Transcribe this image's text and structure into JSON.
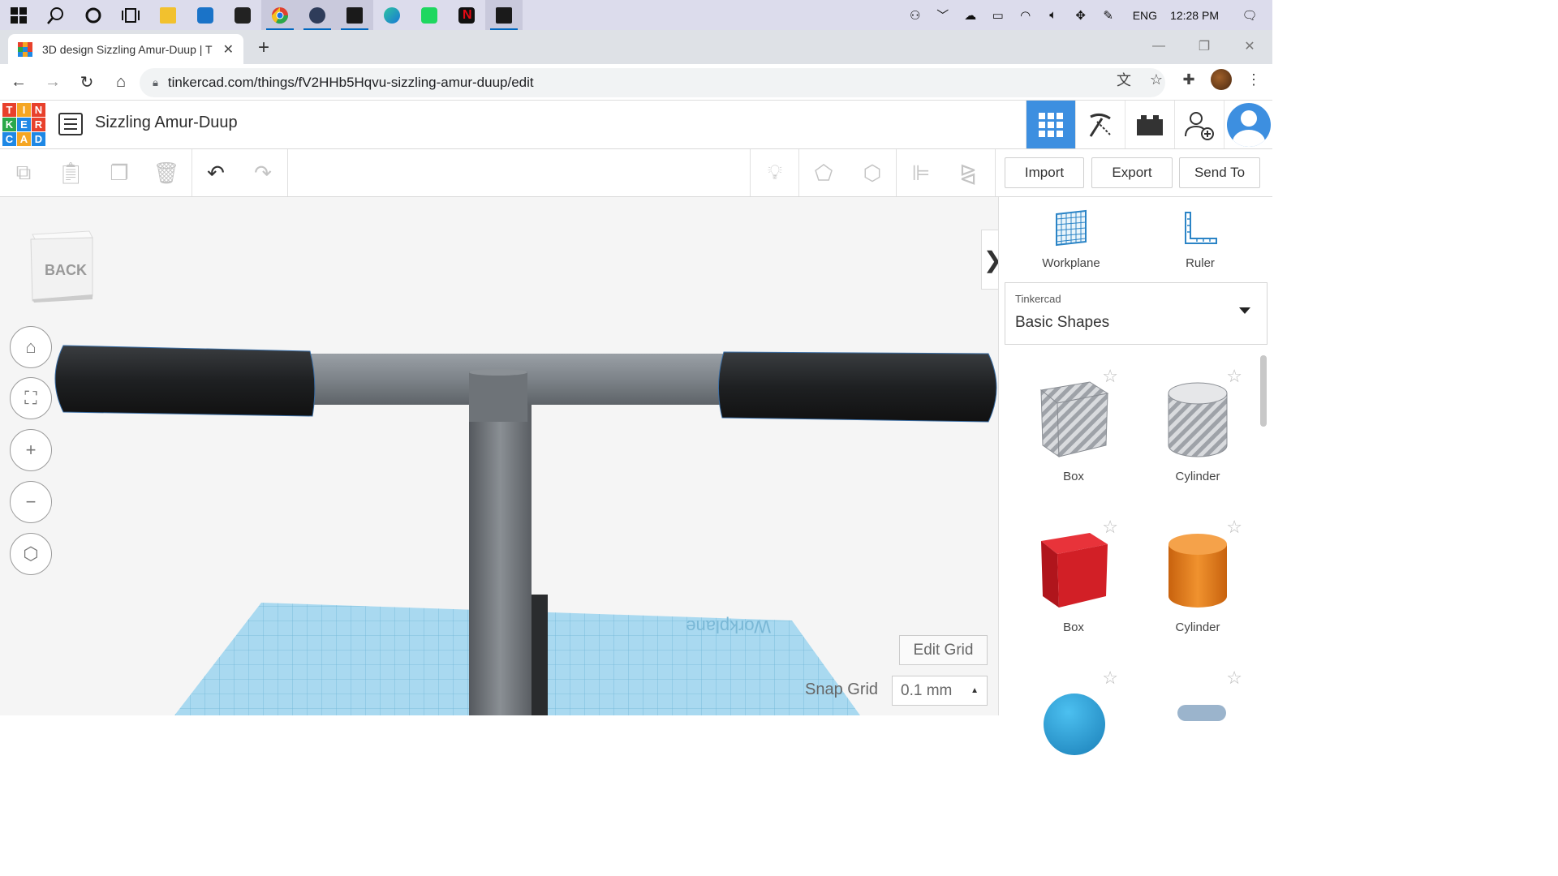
{
  "taskbar": {
    "time": "12:28 PM",
    "language": "ENG",
    "icons": [
      "windows-start-icon",
      "search-icon",
      "cortana-icon",
      "task-view-icon",
      "file-explorer-icon",
      "mail-icon",
      "store-icon",
      "chrome-icon",
      "shield-app-icon",
      "epic-games-icon",
      "edge-icon",
      "spotify-icon",
      "netflix-icon",
      "epic-games-icon-2"
    ]
  },
  "browser": {
    "tab_title": "3D design Sizzling Amur-Duup | T",
    "url": "tinkercad.com/things/fV2HHb5Hqvu-sizzling-amur-duup/edit"
  },
  "app": {
    "logo": [
      "T",
      "I",
      "N",
      "K",
      "E",
      "R",
      "C",
      "A",
      "D"
    ],
    "logo_colors": [
      "#e8412c",
      "#f5a623",
      "#e8412c",
      "#2aa84a",
      "#1e88e5",
      "#e8412c",
      "#1e88e5",
      "#f5a623",
      "#1e88e5"
    ],
    "design_title": "Sizzling Amur-Duup",
    "accent": "#3d8fe0"
  },
  "toolbar": {
    "import_label": "Import",
    "export_label": "Export",
    "send_to_label": "Send To"
  },
  "viewcube": {
    "face_label": "BACK"
  },
  "workspace": {
    "edit_grid_label": "Edit Grid",
    "snap_grid_label": "Snap Grid",
    "snap_grid_value": "0.1 mm",
    "workplane_text": "Workplane"
  },
  "panel": {
    "workplane_label": "Workplane",
    "ruler_label": "Ruler",
    "library_source": "Tinkercad",
    "library_name": "Basic Shapes",
    "shapes": [
      {
        "label": "Box",
        "kind": "box-hole"
      },
      {
        "label": "Cylinder",
        "kind": "cylinder-hole"
      },
      {
        "label": "Box",
        "kind": "box-solid",
        "color": "#d21f26"
      },
      {
        "label": "Cylinder",
        "kind": "cylinder-solid",
        "color": "#e8821e"
      }
    ]
  }
}
